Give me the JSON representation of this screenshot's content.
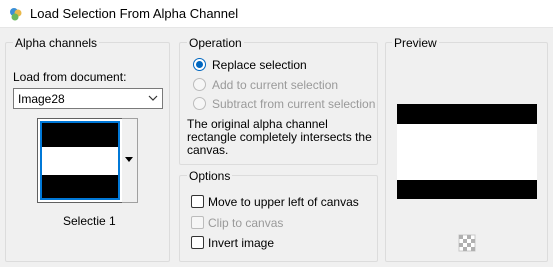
{
  "window": {
    "title": "Load Selection From Alpha Channel"
  },
  "alpha": {
    "group_title": "Alpha channels",
    "load_label": "Load from document:",
    "document_value": "Image28",
    "channel_name": "Selectie 1"
  },
  "operation": {
    "group_title": "Operation",
    "options": [
      {
        "label": "Replace selection",
        "checked": true,
        "enabled": true
      },
      {
        "label": "Add to current selection",
        "checked": false,
        "enabled": false
      },
      {
        "label": "Subtract from current selection",
        "checked": false,
        "enabled": false
      }
    ],
    "description": "The original alpha channel rectangle completely intersects the canvas."
  },
  "options": {
    "group_title": "Options",
    "items": [
      {
        "label": "Move to upper left of canvas",
        "checked": false,
        "enabled": true
      },
      {
        "label": "Clip to canvas",
        "checked": false,
        "enabled": false
      },
      {
        "label": "Invert image",
        "checked": false,
        "enabled": true
      }
    ]
  },
  "preview": {
    "group_title": "Preview"
  },
  "colors": {
    "accent": "#0078d7",
    "selection_border": "#0078d7",
    "disabled_text": "#9a9a9a"
  }
}
